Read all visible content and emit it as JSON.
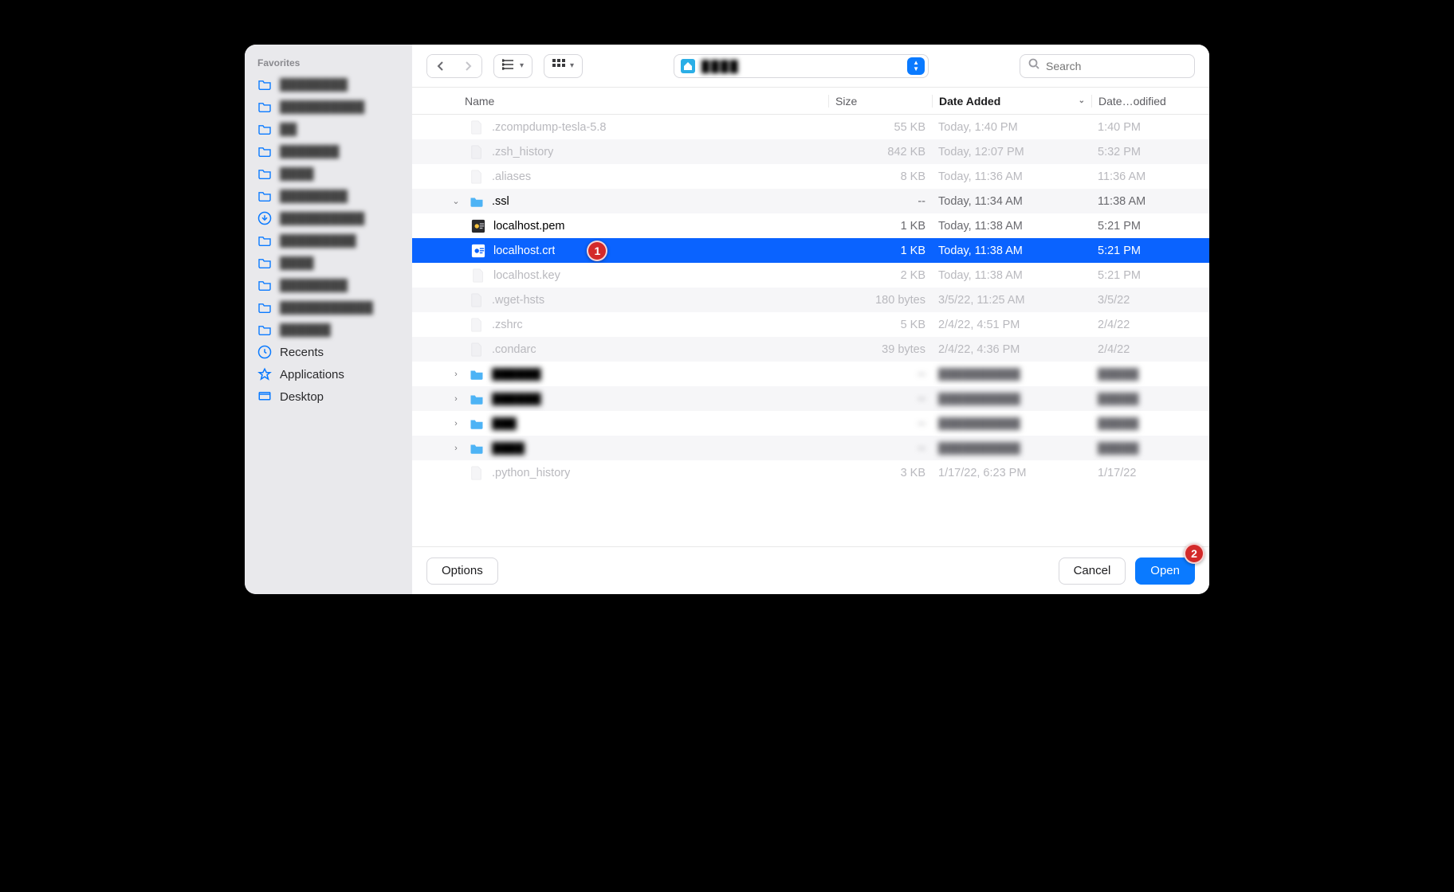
{
  "sidebar": {
    "header": "Favorites",
    "recents": "Recents",
    "applications": "Applications",
    "desktop": "Desktop"
  },
  "toolbar": {
    "path_text": "████",
    "search_placeholder": "Search"
  },
  "columns": {
    "name": "Name",
    "size": "Size",
    "date_added": "Date Added",
    "date_modified": "Date…odified"
  },
  "rows": [
    {
      "indent": 0,
      "kind": "doc",
      "dim": true,
      "name": ".zcompdump-tesla-5.8",
      "size": "55 KB",
      "date": "Today, 1:40 PM",
      "mod": "1:40 PM"
    },
    {
      "indent": 0,
      "kind": "doc",
      "dim": true,
      "name": ".zsh_history",
      "size": "842 KB",
      "date": "Today, 12:07 PM",
      "mod": "5:32 PM"
    },
    {
      "indent": 0,
      "kind": "doc",
      "dim": true,
      "name": ".aliases",
      "size": "8 KB",
      "date": "Today, 11:36 AM",
      "mod": "11:36 AM"
    },
    {
      "indent": 0,
      "kind": "folder",
      "dim": false,
      "expanded": true,
      "name": ".ssl",
      "size": "--",
      "date": "Today, 11:34 AM",
      "mod": "11:38 AM"
    },
    {
      "indent": 1,
      "kind": "cert",
      "dim": false,
      "name": "localhost.pem",
      "size": "1 KB",
      "date": "Today, 11:38 AM",
      "mod": "5:21 PM"
    },
    {
      "indent": 1,
      "kind": "cert",
      "dim": false,
      "selected": true,
      "callout": "1",
      "name": "localhost.crt",
      "size": "1 KB",
      "date": "Today, 11:38 AM",
      "mod": "5:21 PM"
    },
    {
      "indent": 1,
      "kind": "doc",
      "dim": true,
      "name": "localhost.key",
      "size": "2 KB",
      "date": "Today, 11:38 AM",
      "mod": "5:21 PM"
    },
    {
      "indent": 0,
      "kind": "doc",
      "dim": true,
      "name": ".wget-hsts",
      "size": "180 bytes",
      "date": "3/5/22, 11:25 AM",
      "mod": "3/5/22"
    },
    {
      "indent": 0,
      "kind": "doc",
      "dim": true,
      "name": ".zshrc",
      "size": "5 KB",
      "date": "2/4/22, 4:51 PM",
      "mod": "2/4/22"
    },
    {
      "indent": 0,
      "kind": "doc",
      "dim": true,
      "name": ".condarc",
      "size": "39 bytes",
      "date": "2/4/22, 4:36 PM",
      "mod": "2/4/22"
    },
    {
      "indent": 0,
      "kind": "folder",
      "dim": false,
      "blur": true,
      "name": "██████",
      "size": "--",
      "date": "██████████",
      "mod": "█████"
    },
    {
      "indent": 0,
      "kind": "folder",
      "dim": false,
      "blur": true,
      "name": "██████",
      "size": "--",
      "date": "██████████",
      "mod": "█████"
    },
    {
      "indent": 0,
      "kind": "folder",
      "dim": false,
      "blur": true,
      "name": "███",
      "size": "--",
      "date": "██████████",
      "mod": "█████"
    },
    {
      "indent": 0,
      "kind": "folder",
      "dim": false,
      "blur": true,
      "name": "████",
      "size": "--",
      "date": "██████████",
      "mod": "█████"
    },
    {
      "indent": 0,
      "kind": "doc",
      "dim": true,
      "name": ".python_history",
      "size": "3 KB",
      "date": "1/17/22, 6:23 PM",
      "mod": "1/17/22"
    }
  ],
  "footer": {
    "options": "Options",
    "cancel": "Cancel",
    "open": "Open",
    "open_callout": "2"
  }
}
